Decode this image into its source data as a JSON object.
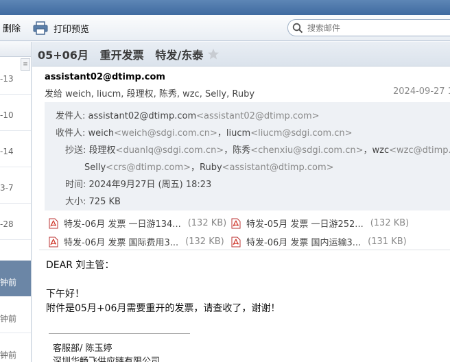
{
  "toolbar": {
    "delete_label": "删除",
    "print_label": "打印预览",
    "search_placeholder": "搜索邮件"
  },
  "list_pane": {
    "items": [
      "-13",
      "-10",
      "-14",
      "3-7",
      "-28",
      "钟前",
      "钟前",
      "钟前"
    ]
  },
  "message": {
    "subject": "05+06月   重开发票   特发/东泰",
    "sender": "assistant02@dtimp.com",
    "recipients_summary": "发给 weich, liucm, 段理权, 陈秀, wzc, Selly, Ruby",
    "date_short": "2024-09-27 1",
    "details": {
      "from_label": "发件人:",
      "from_name": "assistant02@dtimp.com",
      "from_addr": "<assistant02@dtimp.com>",
      "to_label": "收件人:",
      "to_1_name": "weich",
      "to_1_addr": "<weich@sdgi.com.cn>",
      "to_2_name": "liucm",
      "to_2_addr": "<liucm@sdgi.com.cn>",
      "cc_label": "抄送:",
      "cc_1_name": "段理权",
      "cc_1_addr": "<duanlq@sdgi.com.cn>",
      "cc_2_name": "陈秀",
      "cc_2_addr": "<chenxiu@sdgi.com.cn>",
      "cc_3_name": "wzc",
      "cc_3_addr": "<wzc@dtimp.com",
      "cc_4_name": "Selly",
      "cc_4_addr": "<crs@dtimp.com>",
      "cc_5_name": "Ruby",
      "cc_5_addr": "<assistant@dtimp.com>",
      "sep": "，",
      "time_label": "时间:",
      "time_value": "2024年9月27日 (周五) 18:23",
      "size_label": "大小:",
      "size_value": "725 KB"
    },
    "attachments": [
      {
        "name": "特发-06月 发票 一日游134...",
        "size": "(132 KB)"
      },
      {
        "name": "特发-05月 发票 一日游252...",
        "size": "(132 KB)"
      },
      {
        "name": "特发-06月 发票 国际费用3...",
        "size": "(132 KB)"
      },
      {
        "name": "特发-06月 发票 国内运输3...",
        "size": "(131 KB)"
      }
    ],
    "body": {
      "greeting": "DEAR  刘主管：",
      "line1": "下午好！",
      "line2": "附件是05月+06月需要重开的发票，请查收了，谢谢！"
    },
    "signature": {
      "dept": "客服部/ 陈玉婷",
      "company": "深圳华畅飞供应链有限公司"
    }
  },
  "colors": {
    "titlebar": "#4a76aa",
    "selected_item": "#6b86a6",
    "details_bg": "#eef1f5",
    "pdf_red": "#d23a2e"
  }
}
